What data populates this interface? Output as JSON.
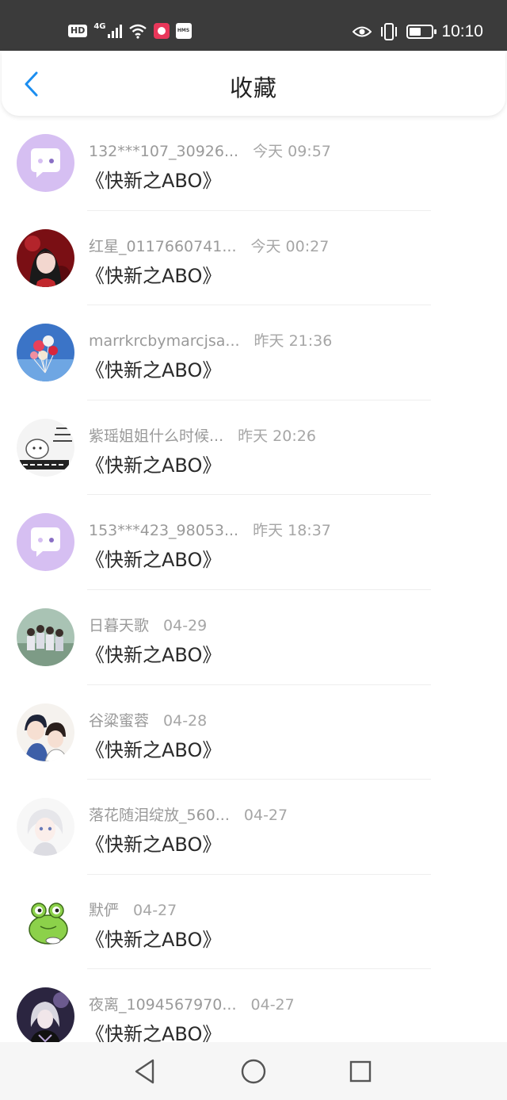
{
  "status_bar": {
    "hd": "HD",
    "network": "4G",
    "hms": "HMS",
    "time": "10:10",
    "icons": [
      "hd-icon",
      "signal-icon",
      "wifi-icon",
      "app-icon",
      "hms-icon",
      "eye-icon",
      "vibrate-icon",
      "battery-icon"
    ]
  },
  "header": {
    "title": "收藏",
    "back_icon": "chevron-left-icon",
    "accent": "#1b8ef0"
  },
  "favorites": [
    {
      "user": "132***107_30926...",
      "time": "今天 09:57",
      "book": "《快新之ABO》",
      "avatar": "chat-bubble"
    },
    {
      "user": "红星_0117660741...",
      "time": "今天 00:27",
      "book": "《快新之ABO》",
      "avatar": "girl-red"
    },
    {
      "user": "marrkrcbymarcjsa...",
      "time": "昨天 21:36",
      "book": "《快新之ABO》",
      "avatar": "balloons"
    },
    {
      "user": "紫瑶姐姐什么时候...",
      "time": "昨天 20:26",
      "book": "《快新之ABO》",
      "avatar": "meme"
    },
    {
      "user": "153***423_98053...",
      "time": "昨天 18:37",
      "book": "《快新之ABO》",
      "avatar": "chat-bubble"
    },
    {
      "user": "日暮天歌",
      "time": "04-29",
      "book": "《快新之ABO》",
      "avatar": "group-photo"
    },
    {
      "user": "谷粱蜜蓉",
      "time": "04-28",
      "book": "《快新之ABO》",
      "avatar": "anime-boys"
    },
    {
      "user": "落花随泪绽放_560...",
      "time": "04-27",
      "book": "《快新之ABO》",
      "avatar": "anime-white"
    },
    {
      "user": "默俨",
      "time": "04-27",
      "book": "《快新之ABO》",
      "avatar": "frog"
    },
    {
      "user": "夜离_1094567970...",
      "time": "04-27",
      "book": "《快新之ABO》",
      "avatar": "anime-dark"
    }
  ],
  "nav": {
    "back_icon": "triangle-back-icon",
    "home_icon": "circle-home-icon",
    "recent_icon": "square-recents-icon"
  }
}
